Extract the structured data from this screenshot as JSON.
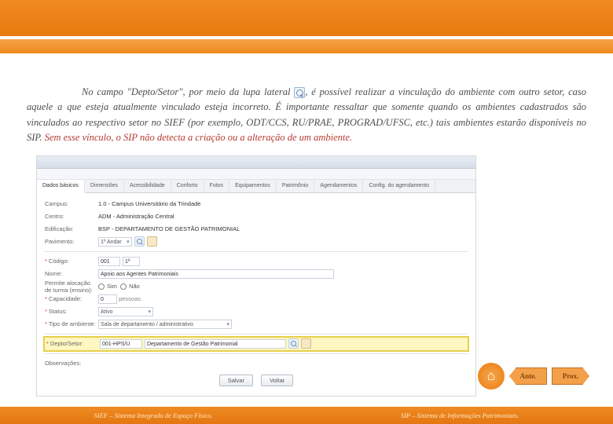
{
  "paragraph": {
    "p1a": "No campo ",
    "field": "\"Depto/Setor\"",
    "p1b": ", por meio da lupa lateral ",
    "p1c": ", é possível realizar a vinculação do ambiente com outro setor, caso aquele a que esteja atualmente vinculado esteja incorreto. É importante ressaltar que somente quando os ambientes cadastrados são vinculados ao respectivo setor no SIEF (por exemplo, ODT/CCS, RU/PRAE, PROGRAD/UFSC, etc.) tais ambientes estarão disponíveis no SIP. ",
    "warn": "Sem esse vínculo, o SIP não detecta a criação ou a alteração de um ambiente."
  },
  "tabs": [
    "Dados básicos",
    "Dimensões",
    "Acessibilidade",
    "Conforto",
    "Fotos",
    "Equipamentos",
    "Patrimônio",
    "Agendamentos",
    "Config. do agendamento"
  ],
  "form": {
    "campus_l": "Campus:",
    "campus_v": "1.0 - Campus Universitário da Trindade",
    "centro_l": "Centro:",
    "centro_v": "ADM - Administração Central",
    "edif_l": "Edificação:",
    "edif_v": "BSP - DEPARTAMENTO DE GESTÃO PATRIMONIAL",
    "pav_l": "Pavimento:",
    "pav_v": "1º Andar",
    "cod_l": "Código:",
    "cod_a": "001",
    "cod_b": "1º",
    "nome_l": "Nome:",
    "nome_v": "Apoio aos Agentes Patrimoniais",
    "turno_l": "Permite alocação de turma (ensino):",
    "sim": "Sim",
    "nao": "Não",
    "cap_l": "Capacidade:",
    "cap_v": "0",
    "cap_u": "pessoas",
    "status_l": "Status:",
    "status_v": "Ativo",
    "tipo_l": "Tipo de ambiente:",
    "tipo_v": "Sala de departamento / administrativo",
    "depto_l": "Depto/Setor:",
    "depto_a": "001-HPS/U",
    "depto_b": "Departamento de Gestão Patrimonial",
    "obs_l": "Observações:",
    "save": "Salvar",
    "back": "Voltar"
  },
  "nav": {
    "prev": "Ante.",
    "next": "Prox."
  },
  "footer": {
    "l1a": "SIEF – ",
    "l1b": "Sistema Integrado de Espaço Físico.",
    "l2a": "SIP – ",
    "l2b": "Sistema de Informações Patrimoniais."
  }
}
